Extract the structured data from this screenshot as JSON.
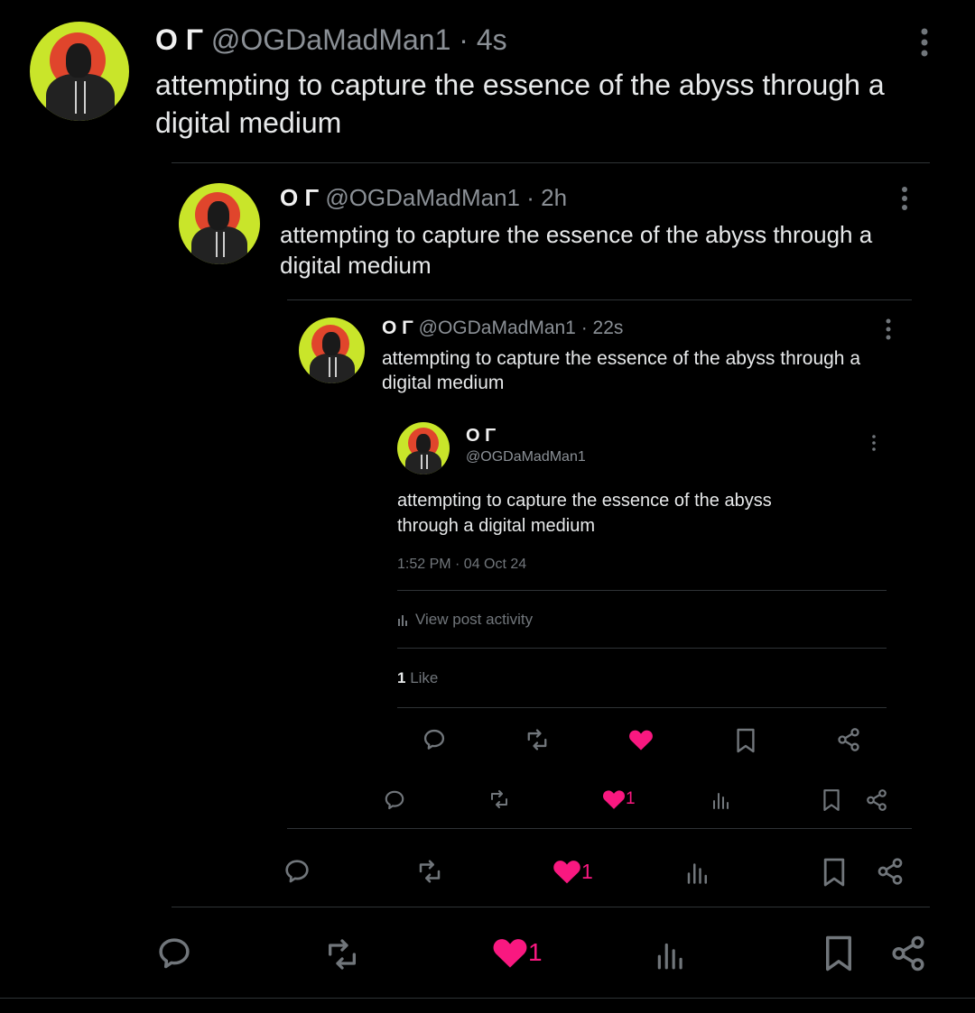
{
  "post1": {
    "display_name": "Ο Γ",
    "handle": "@OGDaMadMan1",
    "time": "· 4s",
    "text": "attempting to capture the essence of the abyss through a digital medium",
    "like_count": "1"
  },
  "post2": {
    "display_name": "Ο Γ",
    "handle": "@OGDaMadMan1",
    "time": "· 2h",
    "text": "attempting to capture the essence of the abyss through a digital medium",
    "like_count": "1"
  },
  "post3": {
    "display_name": "Ο Γ",
    "handle": "@OGDaMadMan1",
    "time": "· 22s",
    "text": "attempting to capture the essence of the abyss through a digital medium",
    "like_count": "1"
  },
  "post4": {
    "display_name": "Ο Γ",
    "handle": "@OGDaMadMan1",
    "text": "attempting to capture the essence of the abyss through a digital medium",
    "timestamp": "1:52 PM · 04 Oct 24",
    "view_activity": "View post activity",
    "likes_count": "1",
    "likes_label": "Like"
  },
  "colors": {
    "background": "#000000",
    "like_pink": "#f91880",
    "icon_gray": "#71767b",
    "avatar_lime": "#c9e52a",
    "avatar_sun": "#e0452c"
  },
  "icons": [
    "reply-icon",
    "retweet-icon",
    "heart-icon",
    "views-icon",
    "bookmark-icon",
    "share-icon",
    "more-icon"
  ]
}
